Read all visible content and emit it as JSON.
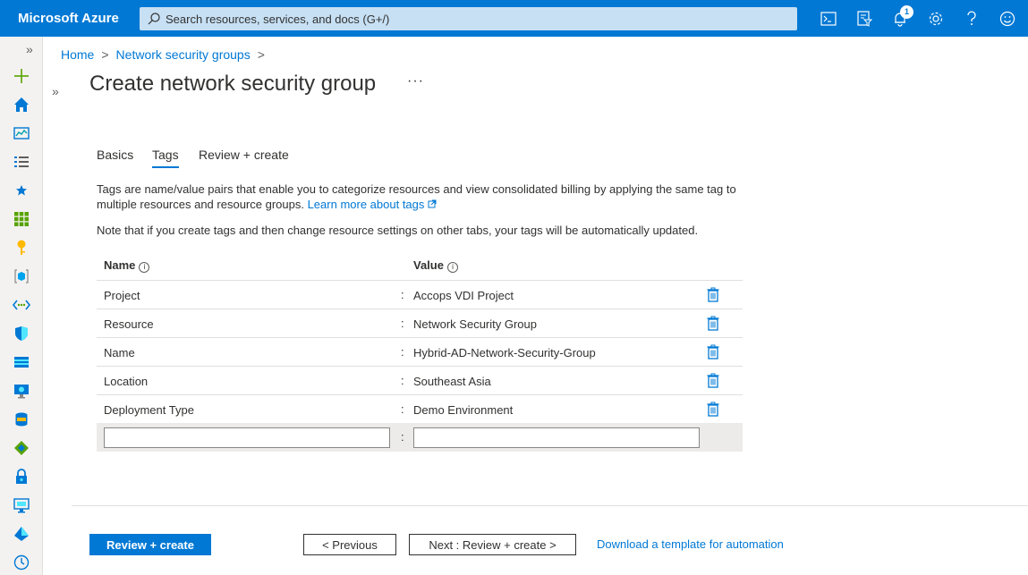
{
  "header": {
    "brand": "Microsoft Azure",
    "search_placeholder": "Search resources, services, and docs (G+/)",
    "notification_count": "1",
    "icons": [
      "cloud-shell-icon",
      "directory-filter-icon",
      "notifications-icon",
      "settings-icon",
      "help-icon",
      "feedback-icon"
    ]
  },
  "rail": {
    "expand": "»",
    "icons": [
      "create-resource-icon",
      "home-icon",
      "dashboard-icon",
      "all-services-icon",
      "favorites-icon",
      "all-resources-icon",
      "key-icon",
      "resource-groups-icon",
      "network-icon",
      "security-icon",
      "storage-icon",
      "monitor-icon",
      "sql-icon",
      "devops-icon",
      "lock-icon",
      "virtual-desktop-icon",
      "azure-ad-icon",
      "recent-icon"
    ]
  },
  "breadcrumb": {
    "home": "Home",
    "parent": "Network security groups",
    "sep": ">"
  },
  "collapse": "»",
  "page": {
    "title": "Create network security group",
    "more": "···"
  },
  "tabs": [
    {
      "label": "Basics"
    },
    {
      "label": "Tags"
    },
    {
      "label": "Review + create"
    }
  ],
  "description": {
    "text": "Tags are name/value pairs that enable you to categorize resources and view consolidated billing by applying the same tag to multiple resources and resource groups.",
    "link": "Learn more about tags"
  },
  "note": "Note that if you create tags and then change resource settings on other tabs, your tags will be automatically updated.",
  "table": {
    "headers": {
      "name": "Name",
      "value": "Value"
    },
    "separator": ":",
    "rows": [
      {
        "name": "Project",
        "value": "Accops VDI Project"
      },
      {
        "name": "Resource",
        "value": "Network Security Group"
      },
      {
        "name": "Name",
        "value": "Hybrid-AD-Network-Security-Group"
      },
      {
        "name": "Location",
        "value": "Southeast Asia"
      },
      {
        "name": "Deployment Type",
        "value": "Demo Environment"
      }
    ],
    "new_row": {
      "name_value": "",
      "value_value": ""
    }
  },
  "footer": {
    "review_create": "Review + create",
    "previous": "< Previous",
    "next": "Next : Review + create >",
    "download": "Download a template for automation"
  },
  "colors": {
    "accent": "#0078d4",
    "search_bg": "#c7e0f4"
  }
}
